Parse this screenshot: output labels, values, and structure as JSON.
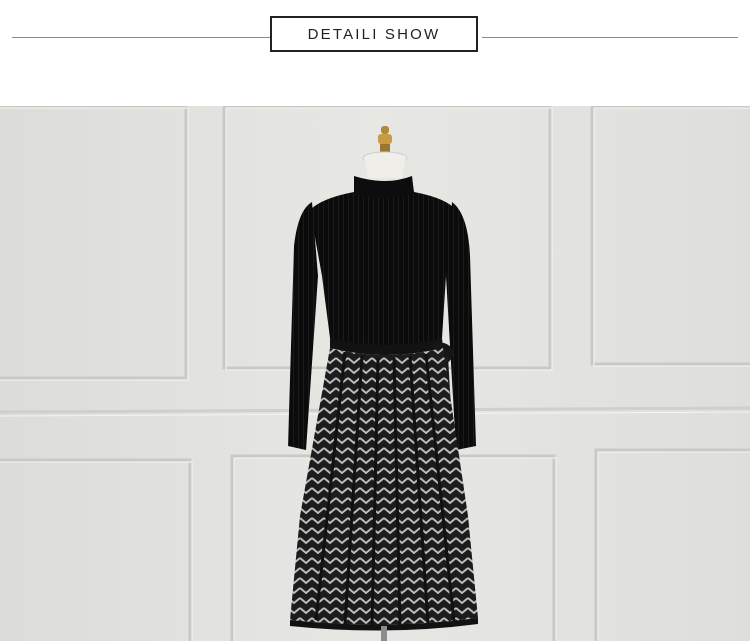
{
  "header": {
    "title": "DETAILI SHOW"
  },
  "photo": {
    "subject": "dress-on-mannequin"
  }
}
